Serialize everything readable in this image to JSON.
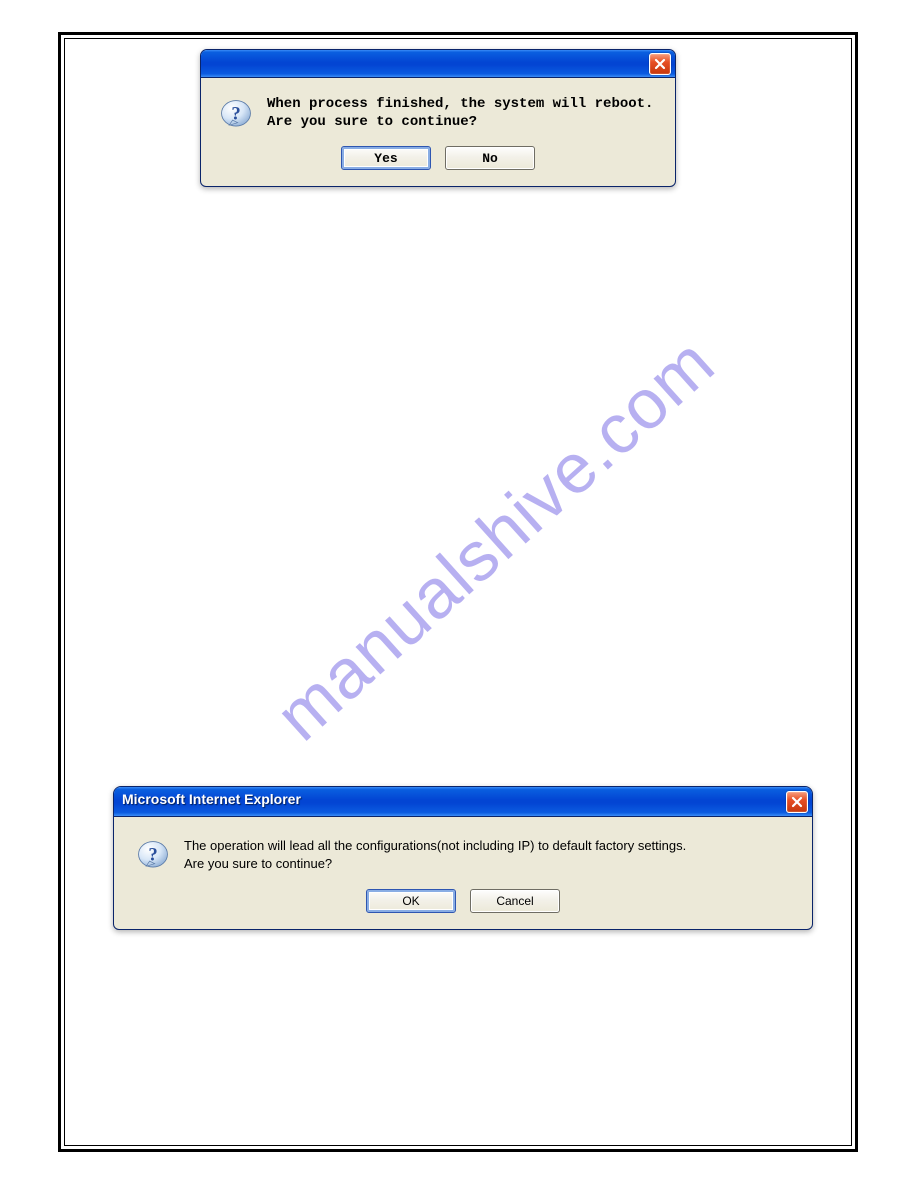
{
  "watermark": "manualshive.com",
  "dialog1": {
    "title": "",
    "message_line1": "When process finished, the system will reboot.",
    "message_line2": "Are you sure to continue?",
    "yes_label": "Yes",
    "no_label": "No"
  },
  "dialog2": {
    "title": "Microsoft Internet Explorer",
    "message_line1": "The operation will lead all the configurations(not including IP) to default factory settings.",
    "message_line2": "Are you sure to continue?",
    "ok_label": "OK",
    "cancel_label": "Cancel"
  },
  "icons": {
    "close": "close-icon",
    "question": "question-mark-icon"
  }
}
